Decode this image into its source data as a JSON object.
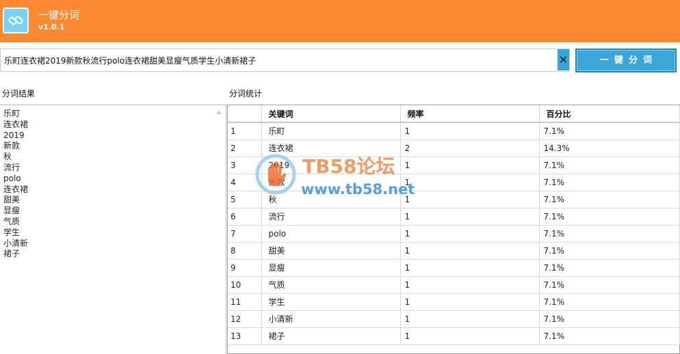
{
  "header": {
    "title": "一键分词",
    "version": "v1.0.1",
    "icon": "link-icon"
  },
  "input": {
    "value": "乐町连衣裙2019新款秋流行polo连衣裙甜美显瘦气质学生小清新裙子",
    "clear_label": "✕"
  },
  "segment_button": {
    "label": "一键分词"
  },
  "results": {
    "label": "分词结果",
    "items": [
      "乐町",
      "连衣裙",
      "2019",
      "新款",
      "秋",
      "流行",
      "polo",
      "连衣裙",
      "甜美",
      "显瘦",
      "气质",
      "学生",
      "小清新",
      "裙子"
    ]
  },
  "stats": {
    "label": "分词统计",
    "columns": [
      "",
      "关键词",
      "频率",
      "百分比"
    ],
    "rows": [
      [
        "1",
        "乐町",
        "1",
        "7.1%"
      ],
      [
        "2",
        "连衣裙",
        "2",
        "14.3%"
      ],
      [
        "3",
        "2019",
        "1",
        "7.1%"
      ],
      [
        "4",
        "新款",
        "1",
        "7.1%"
      ],
      [
        "5",
        "秋",
        "1",
        "7.1%"
      ],
      [
        "6",
        "流行",
        "1",
        "7.1%"
      ],
      [
        "7",
        "polo",
        "1",
        "7.1%"
      ],
      [
        "8",
        "甜美",
        "1",
        "7.1%"
      ],
      [
        "9",
        "显瘦",
        "1",
        "7.1%"
      ],
      [
        "10",
        "气质",
        "1",
        "7.1%"
      ],
      [
        "11",
        "学生",
        "1",
        "7.1%"
      ],
      [
        "12",
        "小清新",
        "1",
        "7.1%"
      ],
      [
        "13",
        "裙子",
        "1",
        "7.1%"
      ]
    ]
  },
  "watermark": {
    "title": "TB58论坛",
    "url": "www.tb58.net",
    "icon": "hand-logo-icon"
  },
  "colors": {
    "header": "#fd8a32",
    "button": "#3aa7d8",
    "watermark_orange": "#f08a4a",
    "watermark_blue": "#3b8fe0"
  }
}
